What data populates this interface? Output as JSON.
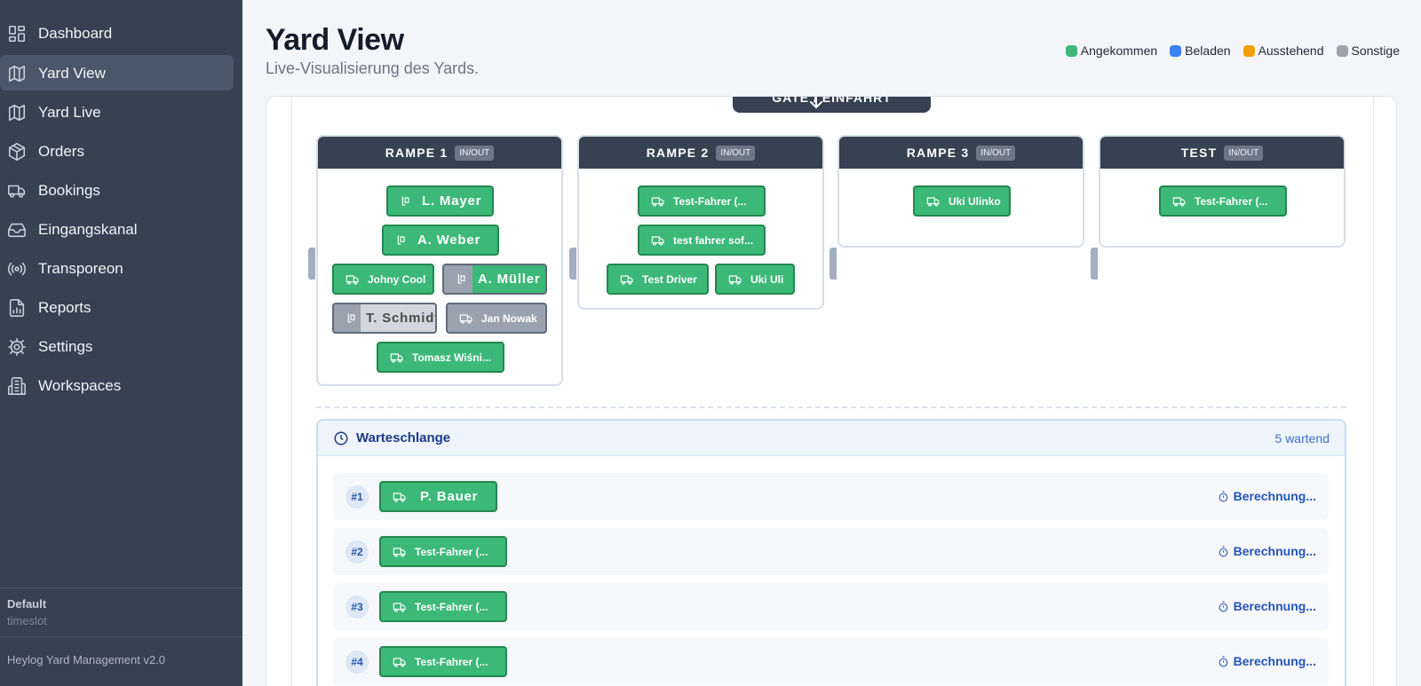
{
  "sidebar": {
    "items": [
      {
        "label": "Dashboard",
        "icon": "grid-icon",
        "active": false
      },
      {
        "label": "Yard View",
        "icon": "map-icon",
        "active": true
      },
      {
        "label": "Yard Live",
        "icon": "map-icon",
        "active": false
      },
      {
        "label": "Orders",
        "icon": "package-icon",
        "active": false
      },
      {
        "label": "Bookings",
        "icon": "truck-icon",
        "active": false
      },
      {
        "label": "Eingangskanal",
        "icon": "inbox-icon",
        "active": false
      },
      {
        "label": "Transporeon",
        "icon": "radio-icon",
        "active": false
      },
      {
        "label": "Reports",
        "icon": "report-icon",
        "active": false
      },
      {
        "label": "Settings",
        "icon": "gear-icon",
        "active": false
      },
      {
        "label": "Workspaces",
        "icon": "building-icon",
        "active": false
      }
    ],
    "workspace": {
      "name": "Default",
      "subtitle": "timeslot"
    },
    "version": "Heylog Yard Management v2.0"
  },
  "header": {
    "title": "Yard View",
    "subtitle": "Live-Visualisierung des Yards."
  },
  "legend": [
    {
      "label": "Angekommen",
      "color": "#3cb878"
    },
    {
      "label": "Beladen",
      "color": "#3b82f6"
    },
    {
      "label": "Ausstehend",
      "color": "#f59e0b"
    },
    {
      "label": "Sonstige",
      "color": "#9ca3af"
    }
  ],
  "gate": {
    "label": "GATE / EINFAHRT"
  },
  "ramps": [
    {
      "name": "RAMPE 1",
      "badge": "IN/OUT",
      "drivers": [
        {
          "label": "L. Mayer",
          "status": "angekommen"
        },
        {
          "label": "A. Weber",
          "status": "angekommen"
        },
        {
          "label": "Johny Cool",
          "status": "angekommen"
        },
        {
          "label": "A. Müller",
          "status": "sonstige"
        },
        {
          "label": "T. Schmidt",
          "status": "sonstige"
        },
        {
          "label": "Jan Nowak",
          "status": "sonstige"
        },
        {
          "label": "Tomasz Wiśni...",
          "status": "angekommen"
        }
      ]
    },
    {
      "name": "RAMPE 2",
      "badge": "IN/OUT",
      "drivers": [
        {
          "label": "Test-Fahrer (...",
          "status": "angekommen"
        },
        {
          "label": "test fahrer sof...",
          "status": "angekommen"
        },
        {
          "label": "Test Driver",
          "status": "angekommen"
        },
        {
          "label": "Uki Uli",
          "status": "angekommen"
        }
      ]
    },
    {
      "name": "RAMPE 3",
      "badge": "IN/OUT",
      "drivers": [
        {
          "label": "Uki Ulinko",
          "status": "angekommen"
        }
      ]
    },
    {
      "name": "TEST",
      "badge": "IN/OUT",
      "drivers": [
        {
          "label": "Test-Fahrer (...",
          "status": "angekommen"
        }
      ]
    }
  ],
  "queue": {
    "title": "Warteschlange",
    "count_label": "5 wartend",
    "rows": [
      {
        "position": "#1",
        "driver": "P. Bauer",
        "eta": "Berechnung..."
      },
      {
        "position": "#2",
        "driver": "Test-Fahrer (...",
        "eta": "Berechnung..."
      },
      {
        "position": "#3",
        "driver": "Test-Fahrer (...",
        "eta": "Berechnung..."
      },
      {
        "position": "#4",
        "driver": "Test-Fahrer (...",
        "eta": "Berechnung..."
      }
    ]
  }
}
